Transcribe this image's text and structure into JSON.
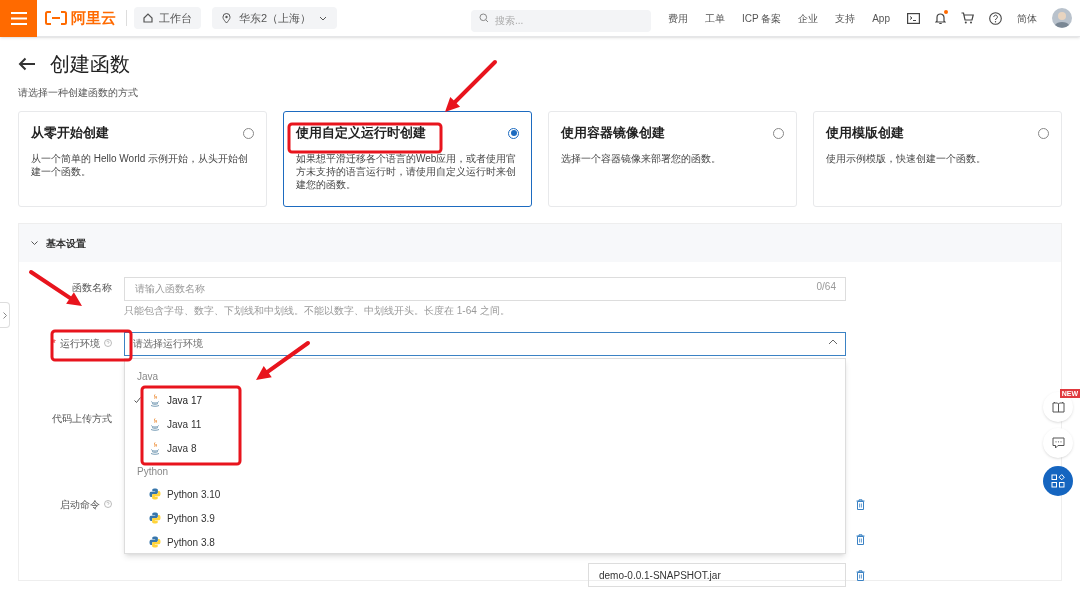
{
  "topbar": {
    "logo": "阿里云",
    "workbench": "工作台",
    "region": "华东2（上海）",
    "search": {
      "placeholder": "搜索..."
    },
    "links": [
      "费用",
      "工单",
      "ICP 备案",
      "企业",
      "支持",
      "App"
    ],
    "notification_dot": true,
    "language": "简体"
  },
  "page": {
    "title": "创建函数",
    "subtitle": "请选择一种创建函数的方式"
  },
  "methods": [
    {
      "title": "从零开始创建",
      "description": "从一个简单的 Hello World 示例开始，从头开始创建一个函数。",
      "selected": false
    },
    {
      "title": "使用自定义运行时创建",
      "description": "如果想平滑迁移各个语言的Web应用，或者使用官方未支持的语言运行时，请使用自定义运行时来创建您的函数。",
      "selected": true
    },
    {
      "title": "使用容器镜像创建",
      "description": "选择一个容器镜像来部署您的函数。",
      "selected": false
    },
    {
      "title": "使用模版创建",
      "description": "使用示例模版，快速创建一个函数。",
      "selected": false
    }
  ],
  "section": {
    "title": "基本设置",
    "expanded": true
  },
  "form": {
    "name": {
      "label": "函数名称",
      "placeholder": "请输入函数名称",
      "counter": "0/64",
      "hint": "只能包含字母、数字、下划线和中划线。不能以数字、中划线开头。长度在 1-64 之间。"
    },
    "runtime": {
      "label": "运行环境",
      "required": true,
      "required_mark": "*",
      "placeholder": "请选择运行环境"
    },
    "upload": {
      "label": "代码上传方式"
    },
    "start": {
      "label": "启动命令"
    },
    "jar_field": {
      "value": "demo-0.0.1-SNAPSHOT.jar"
    }
  },
  "dropdown": {
    "groups": [
      {
        "label": "Java",
        "options": [
          {
            "label": "Java 17",
            "kind": "java",
            "selected": true
          },
          {
            "label": "Java 11",
            "kind": "java",
            "selected": false
          },
          {
            "label": "Java 8",
            "kind": "java",
            "selected": false
          }
        ]
      },
      {
        "label": "Python",
        "options": [
          {
            "label": "Python 3.10",
            "kind": "python",
            "selected": false
          },
          {
            "label": "Python 3.9",
            "kind": "python",
            "selected": false
          },
          {
            "label": "Python 3.8",
            "kind": "python",
            "selected": false
          }
        ]
      }
    ]
  },
  "float_badge": "NEW"
}
